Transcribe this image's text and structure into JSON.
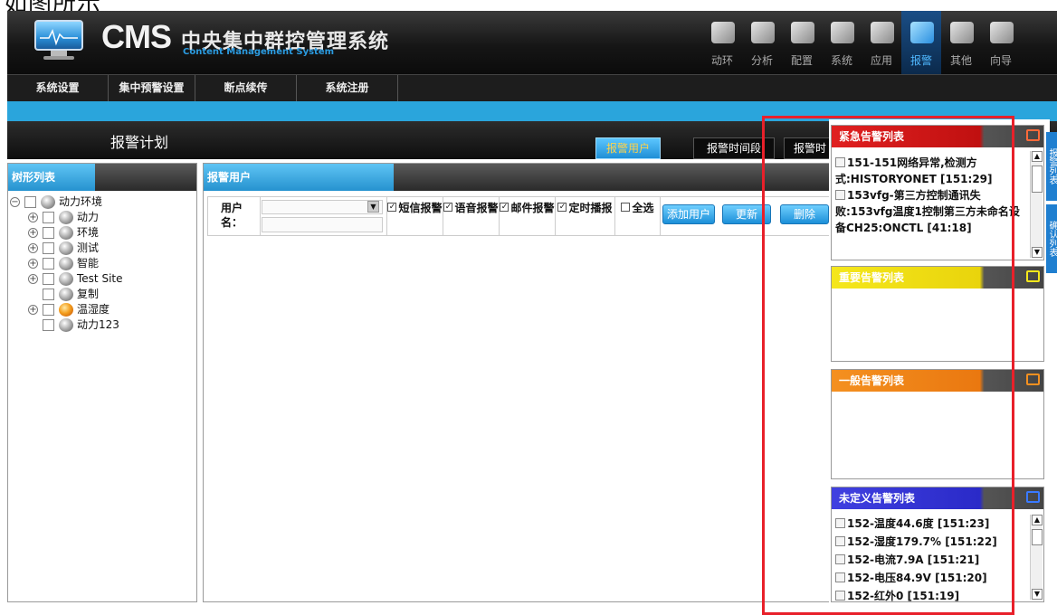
{
  "caption": "如图所示",
  "app": {
    "brand": "CMS",
    "brand_cn": "中央集中群控管理系统",
    "brand_en": "Content Management System"
  },
  "nav": [
    {
      "label": "动环",
      "icon": "equipment-icon",
      "active": false
    },
    {
      "label": "分析",
      "icon": "analysis-icon",
      "active": false
    },
    {
      "label": "配置",
      "icon": "config-icon",
      "active": false
    },
    {
      "label": "系统",
      "icon": "system-icon",
      "active": false
    },
    {
      "label": "应用",
      "icon": "application-icon",
      "active": false
    },
    {
      "label": "报警",
      "icon": "alarm-icon",
      "active": true
    },
    {
      "label": "其他",
      "icon": "other-icon",
      "active": false
    },
    {
      "label": "向导",
      "icon": "wizard-icon",
      "active": false
    }
  ],
  "menu": [
    "系统设置",
    "集中预警设置",
    "断点续传",
    "系统注册"
  ],
  "page": {
    "title": "报警计划",
    "tabs": [
      {
        "label": "报警用户",
        "active": true
      },
      {
        "label": "报警时间段",
        "active": false
      },
      {
        "label": "报警时",
        "active": false
      }
    ]
  },
  "tree": {
    "title": "树形列表",
    "nodes": [
      {
        "label": "动力环境",
        "toggle": "minus",
        "level": 0,
        "icon": "site-icon"
      },
      {
        "label": "动力",
        "toggle": "plus",
        "level": 1,
        "icon": "site-icon"
      },
      {
        "label": "环境",
        "toggle": "plus",
        "level": 1,
        "icon": "site-icon"
      },
      {
        "label": "测试",
        "toggle": "plus",
        "level": 1,
        "icon": "site-icon"
      },
      {
        "label": "智能",
        "toggle": "plus",
        "level": 1,
        "icon": "site-icon"
      },
      {
        "label": "Test Site",
        "toggle": "plus",
        "level": 1,
        "icon": "site-icon"
      },
      {
        "label": "复制",
        "toggle": "none",
        "level": 1,
        "icon": "site-icon"
      },
      {
        "label": "温湿度",
        "toggle": "plus",
        "level": 1,
        "icon": "site-warning-icon"
      },
      {
        "label": "动力123",
        "toggle": "none",
        "level": 1,
        "icon": "site-icon"
      }
    ]
  },
  "users": {
    "title": "报警用户",
    "username_label": "用户名：",
    "checks": [
      {
        "label": "短信报警",
        "checked": true
      },
      {
        "label": "语音报警",
        "checked": true
      },
      {
        "label": "邮件报警",
        "checked": true
      },
      {
        "label": "定时播报",
        "checked": true
      },
      {
        "label": "全选",
        "checked": false
      }
    ],
    "buttons": {
      "add": "添加用户",
      "update": "更新",
      "delete": "删除"
    }
  },
  "alarms": {
    "urgent": {
      "title": "紧急告警列表",
      "color": "#d81c1c",
      "items": [
        "151-151网络异常,检测方式:HISTORYONET [151:29]",
        "153vfg-第三方控制通讯失败:153vfg温度1控制第三方未命名设备CH25:ONCTL [41:18]"
      ]
    },
    "important": {
      "title": "重要告警列表",
      "color": "#f2e21a",
      "items": []
    },
    "normal": {
      "title": "一般告警列表",
      "color": "#f28a1a",
      "items": []
    },
    "undefined": {
      "title": "未定义告警列表",
      "color": "#3a3adc",
      "items": [
        "152-温度44.6度 [151:23]",
        "152-湿度179.7% [151:22]",
        "152-电流7.9A [151:21]",
        "152-电压84.9V [151:20]",
        "152-红外0 [151:19]"
      ]
    }
  },
  "side_tabs": [
    "报警列表",
    "确认列表"
  ]
}
